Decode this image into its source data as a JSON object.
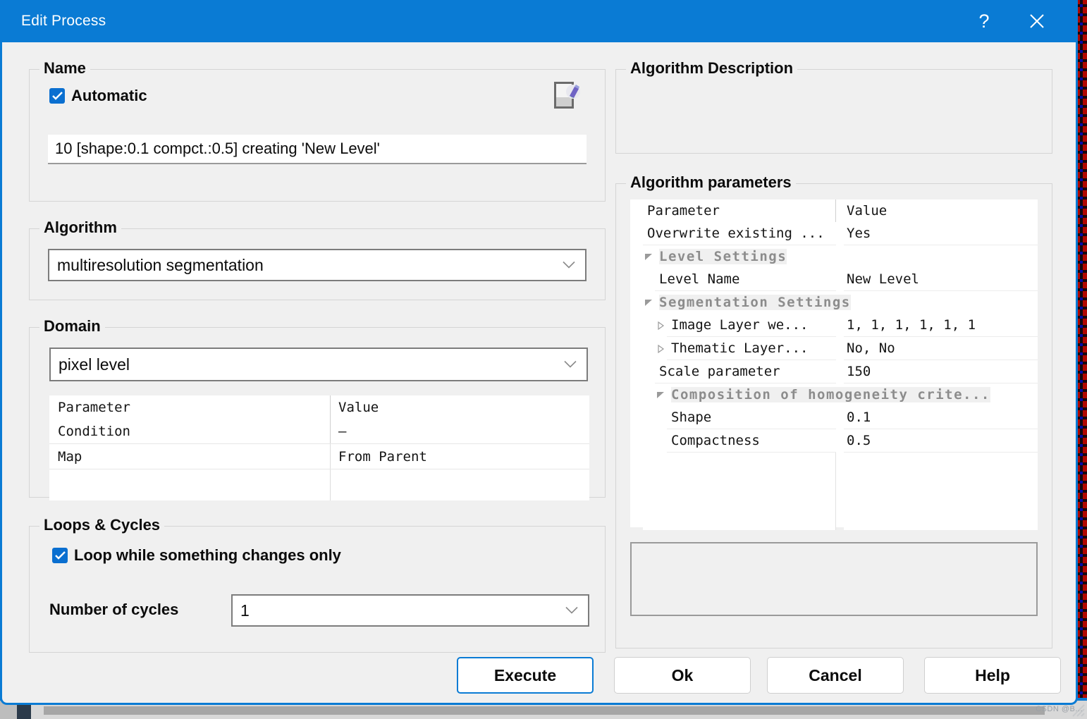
{
  "window": {
    "title": "Edit Process",
    "help_icon": "question-mark-icon",
    "close_icon": "close-x-icon"
  },
  "left": {
    "name_group": {
      "legend": "Name",
      "automatic_label": "Automatic",
      "automatic_checked": true,
      "doc_icon": "document-edit-icon",
      "name_value": "10 [shape:0.1 compct.:0.5] creating 'New Level'"
    },
    "algorithm_group": {
      "legend": "Algorithm",
      "selected": "multiresolution segmentation"
    },
    "domain_group": {
      "legend": "Domain",
      "selected": "pixel level",
      "table": {
        "headers": [
          "Parameter",
          "Value"
        ],
        "rows": [
          {
            "parameter": "Condition",
            "value": "—"
          },
          {
            "parameter": "Map",
            "value": "From Parent"
          },
          {
            "parameter": "",
            "value": ""
          }
        ]
      }
    },
    "loops_group": {
      "legend": "Loops & Cycles",
      "loop_label": "Loop while something changes only",
      "loop_checked": true,
      "cycles_label": "Number of cycles",
      "cycles_value": "1"
    }
  },
  "right": {
    "description_group": {
      "legend": "Algorithm Description",
      "text": ""
    },
    "parameters_group": {
      "legend": "Algorithm parameters",
      "headers": [
        "Parameter",
        "Value"
      ],
      "rows": [
        {
          "parameter": "Overwrite existing ...",
          "value": "Yes",
          "indent": 0,
          "type": "item",
          "toggle": ""
        },
        {
          "parameter": "Level Settings",
          "value": "",
          "indent": 1,
          "type": "group",
          "toggle": "expanded"
        },
        {
          "parameter": "Level Name",
          "value": "New Level",
          "indent": 1,
          "type": "item",
          "toggle": ""
        },
        {
          "parameter": "Segmentation Settings",
          "value": "",
          "indent": 1,
          "type": "group",
          "toggle": "expanded"
        },
        {
          "parameter": "Image Layer we...",
          "value": "1, 1, 1, 1, 1, 1",
          "indent": 2,
          "type": "item",
          "toggle": "collapsed"
        },
        {
          "parameter": "Thematic Layer...",
          "value": "No, No",
          "indent": 2,
          "type": "item",
          "toggle": "collapsed"
        },
        {
          "parameter": "Scale parameter",
          "value": "150",
          "indent": 1,
          "type": "item",
          "toggle": ""
        },
        {
          "parameter": "Composition of homogeneity crite...",
          "value": "",
          "indent": 2,
          "type": "group",
          "toggle": "expanded"
        },
        {
          "parameter": "Shape",
          "value": "0.1",
          "indent": 2,
          "type": "item",
          "toggle": ""
        },
        {
          "parameter": "Compactness",
          "value": "0.5",
          "indent": 2,
          "type": "item",
          "toggle": ""
        },
        {
          "parameter": "",
          "value": "",
          "indent": 0,
          "type": "blank",
          "toggle": ""
        }
      ],
      "description_text": ""
    }
  },
  "buttons": {
    "execute": "Execute",
    "ok": "Ok",
    "cancel": "Cancel",
    "help": "Help"
  },
  "watermark": "CSDN @B...",
  "colors": {
    "accent": "#0a7bd4",
    "checkbox": "#0a6fd0",
    "panel": "#f0f0f0",
    "field": "#ffffff",
    "group_text": "#8c8c8c"
  }
}
